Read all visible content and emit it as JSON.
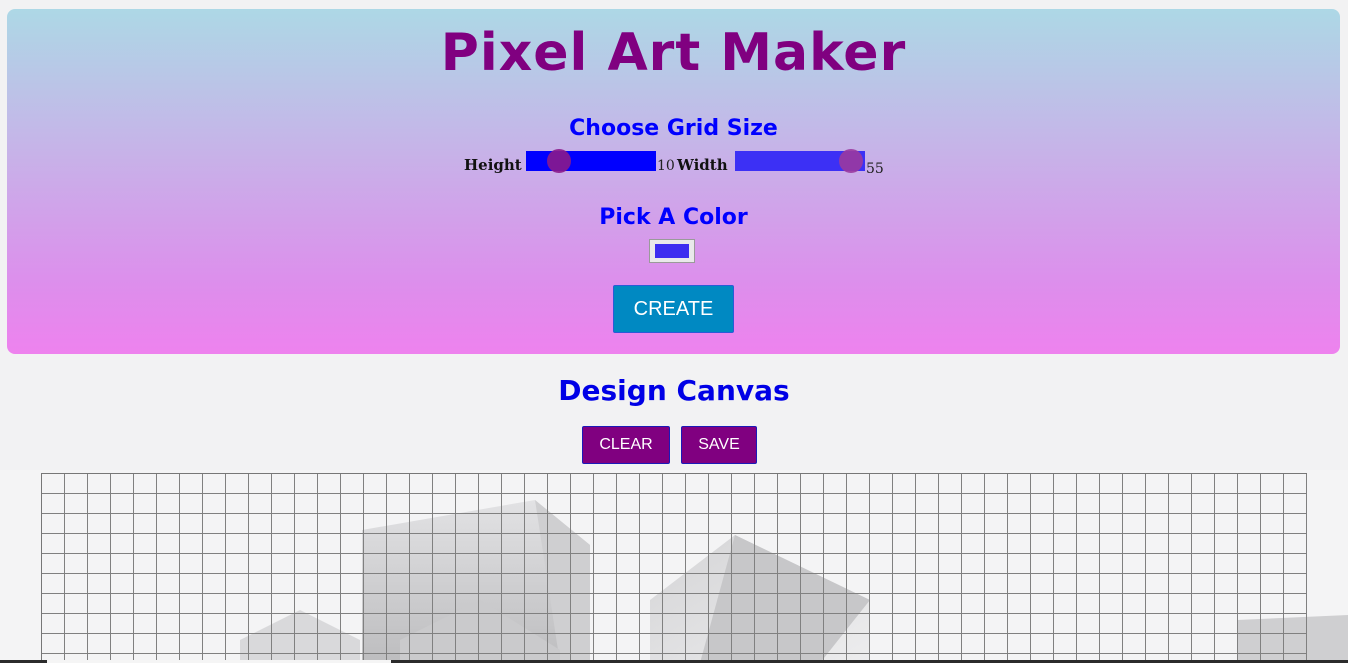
{
  "header": {
    "title": "Pixel Art Maker",
    "grid_heading": "Choose Grid Size",
    "height_label": "Height",
    "height_value": "10",
    "width_label": "Width",
    "width_value": "55",
    "color_heading": "Pick A Color",
    "selected_color": "#3d2df0",
    "create_label": "CREATE"
  },
  "canvas": {
    "heading": "Design Canvas",
    "clear_label": "CLEAR",
    "save_label": "SAVE",
    "rows": 10,
    "columns": 55
  },
  "colors": {
    "title": "#800080",
    "heading": "#0000ff",
    "create_button": "#0089c2",
    "tool_button": "#800080",
    "panel_gradient_top": "#add8e6",
    "panel_gradient_bottom": "#ee82ee"
  }
}
